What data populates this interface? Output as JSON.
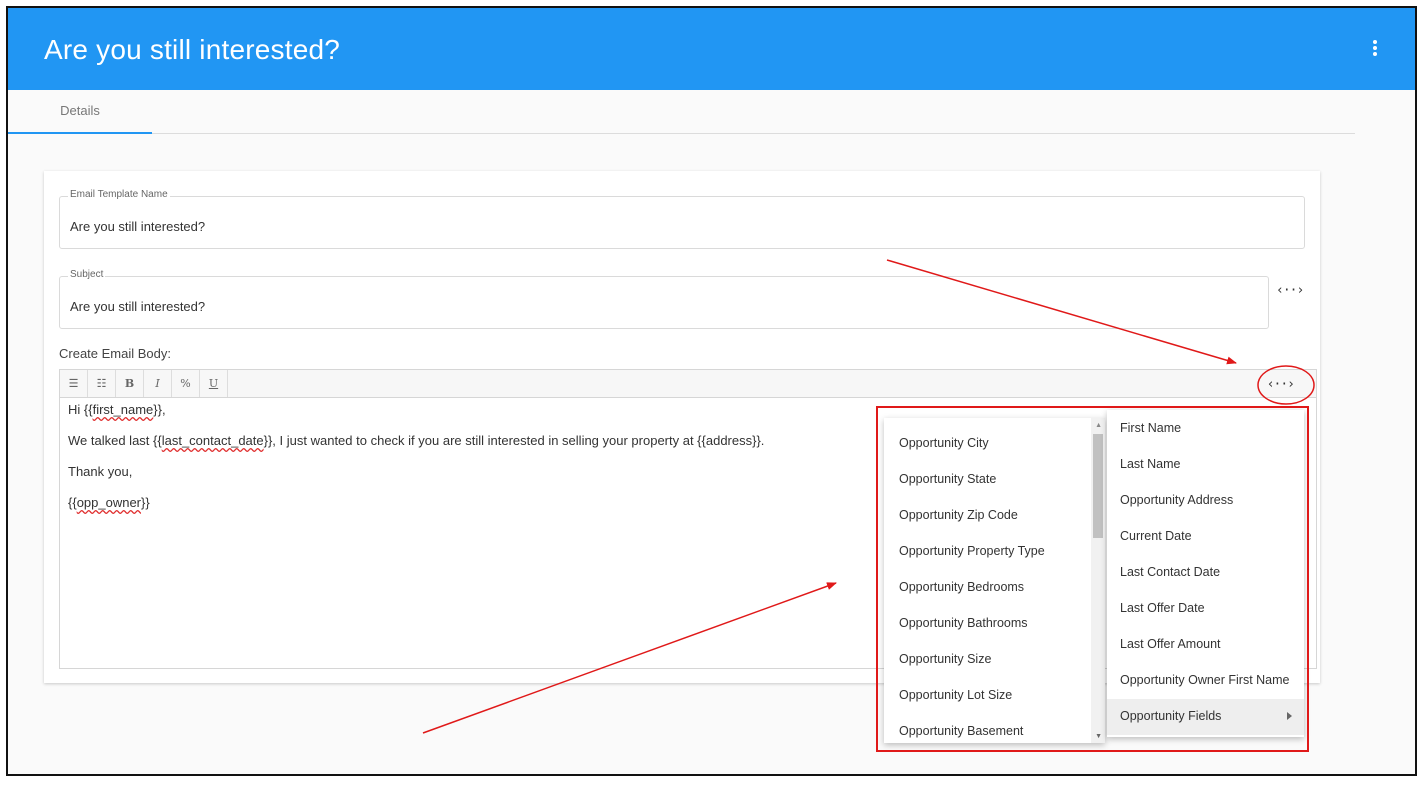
{
  "header": {
    "title": "Are you still interested?"
  },
  "tabs": [
    {
      "label": "Details"
    }
  ],
  "form": {
    "template_name": {
      "label": "Email Template Name",
      "value": "Are you still interested?"
    },
    "subject": {
      "label": "Subject",
      "value": "Are you still interested?"
    },
    "body_label": "Create Email Body:",
    "insert_variable_glyph": "‹··›"
  },
  "toolbar": {
    "bullet_list": "☰",
    "numbered_list": "☷",
    "bold": "B",
    "italic": "I",
    "link": "%",
    "underline": "U"
  },
  "email_body": {
    "line1_pre": "Hi  {{",
    "line1_var": "first_name",
    "line1_post": "}},",
    "line2_pre": "We talked last {{",
    "line2_var": "last_contact_date",
    "line2_post": "}}, I just wanted to check if you are still interested in selling your property at {{address}}.",
    "line3": "Thank you,",
    "line4_pre": "{{",
    "line4_var": "opp_owner",
    "line4_post": "}}"
  },
  "variables_menu": {
    "items": [
      "First Name",
      "Last Name",
      "Opportunity Address",
      "Current Date",
      "Last Contact Date",
      "Last Offer Date",
      "Last Offer Amount",
      "Opportunity Owner First Name",
      "Opportunity Fields"
    ]
  },
  "opportunity_submenu": {
    "items": [
      "Opportunity City",
      "Opportunity State",
      "Opportunity Zip Code",
      "Opportunity Property Type",
      "Opportunity Bedrooms",
      "Opportunity Bathrooms",
      "Opportunity Size",
      "Opportunity Lot Size",
      "Opportunity Basement"
    ]
  },
  "colors": {
    "header": "#2196f3",
    "annotation": "#e01919"
  }
}
